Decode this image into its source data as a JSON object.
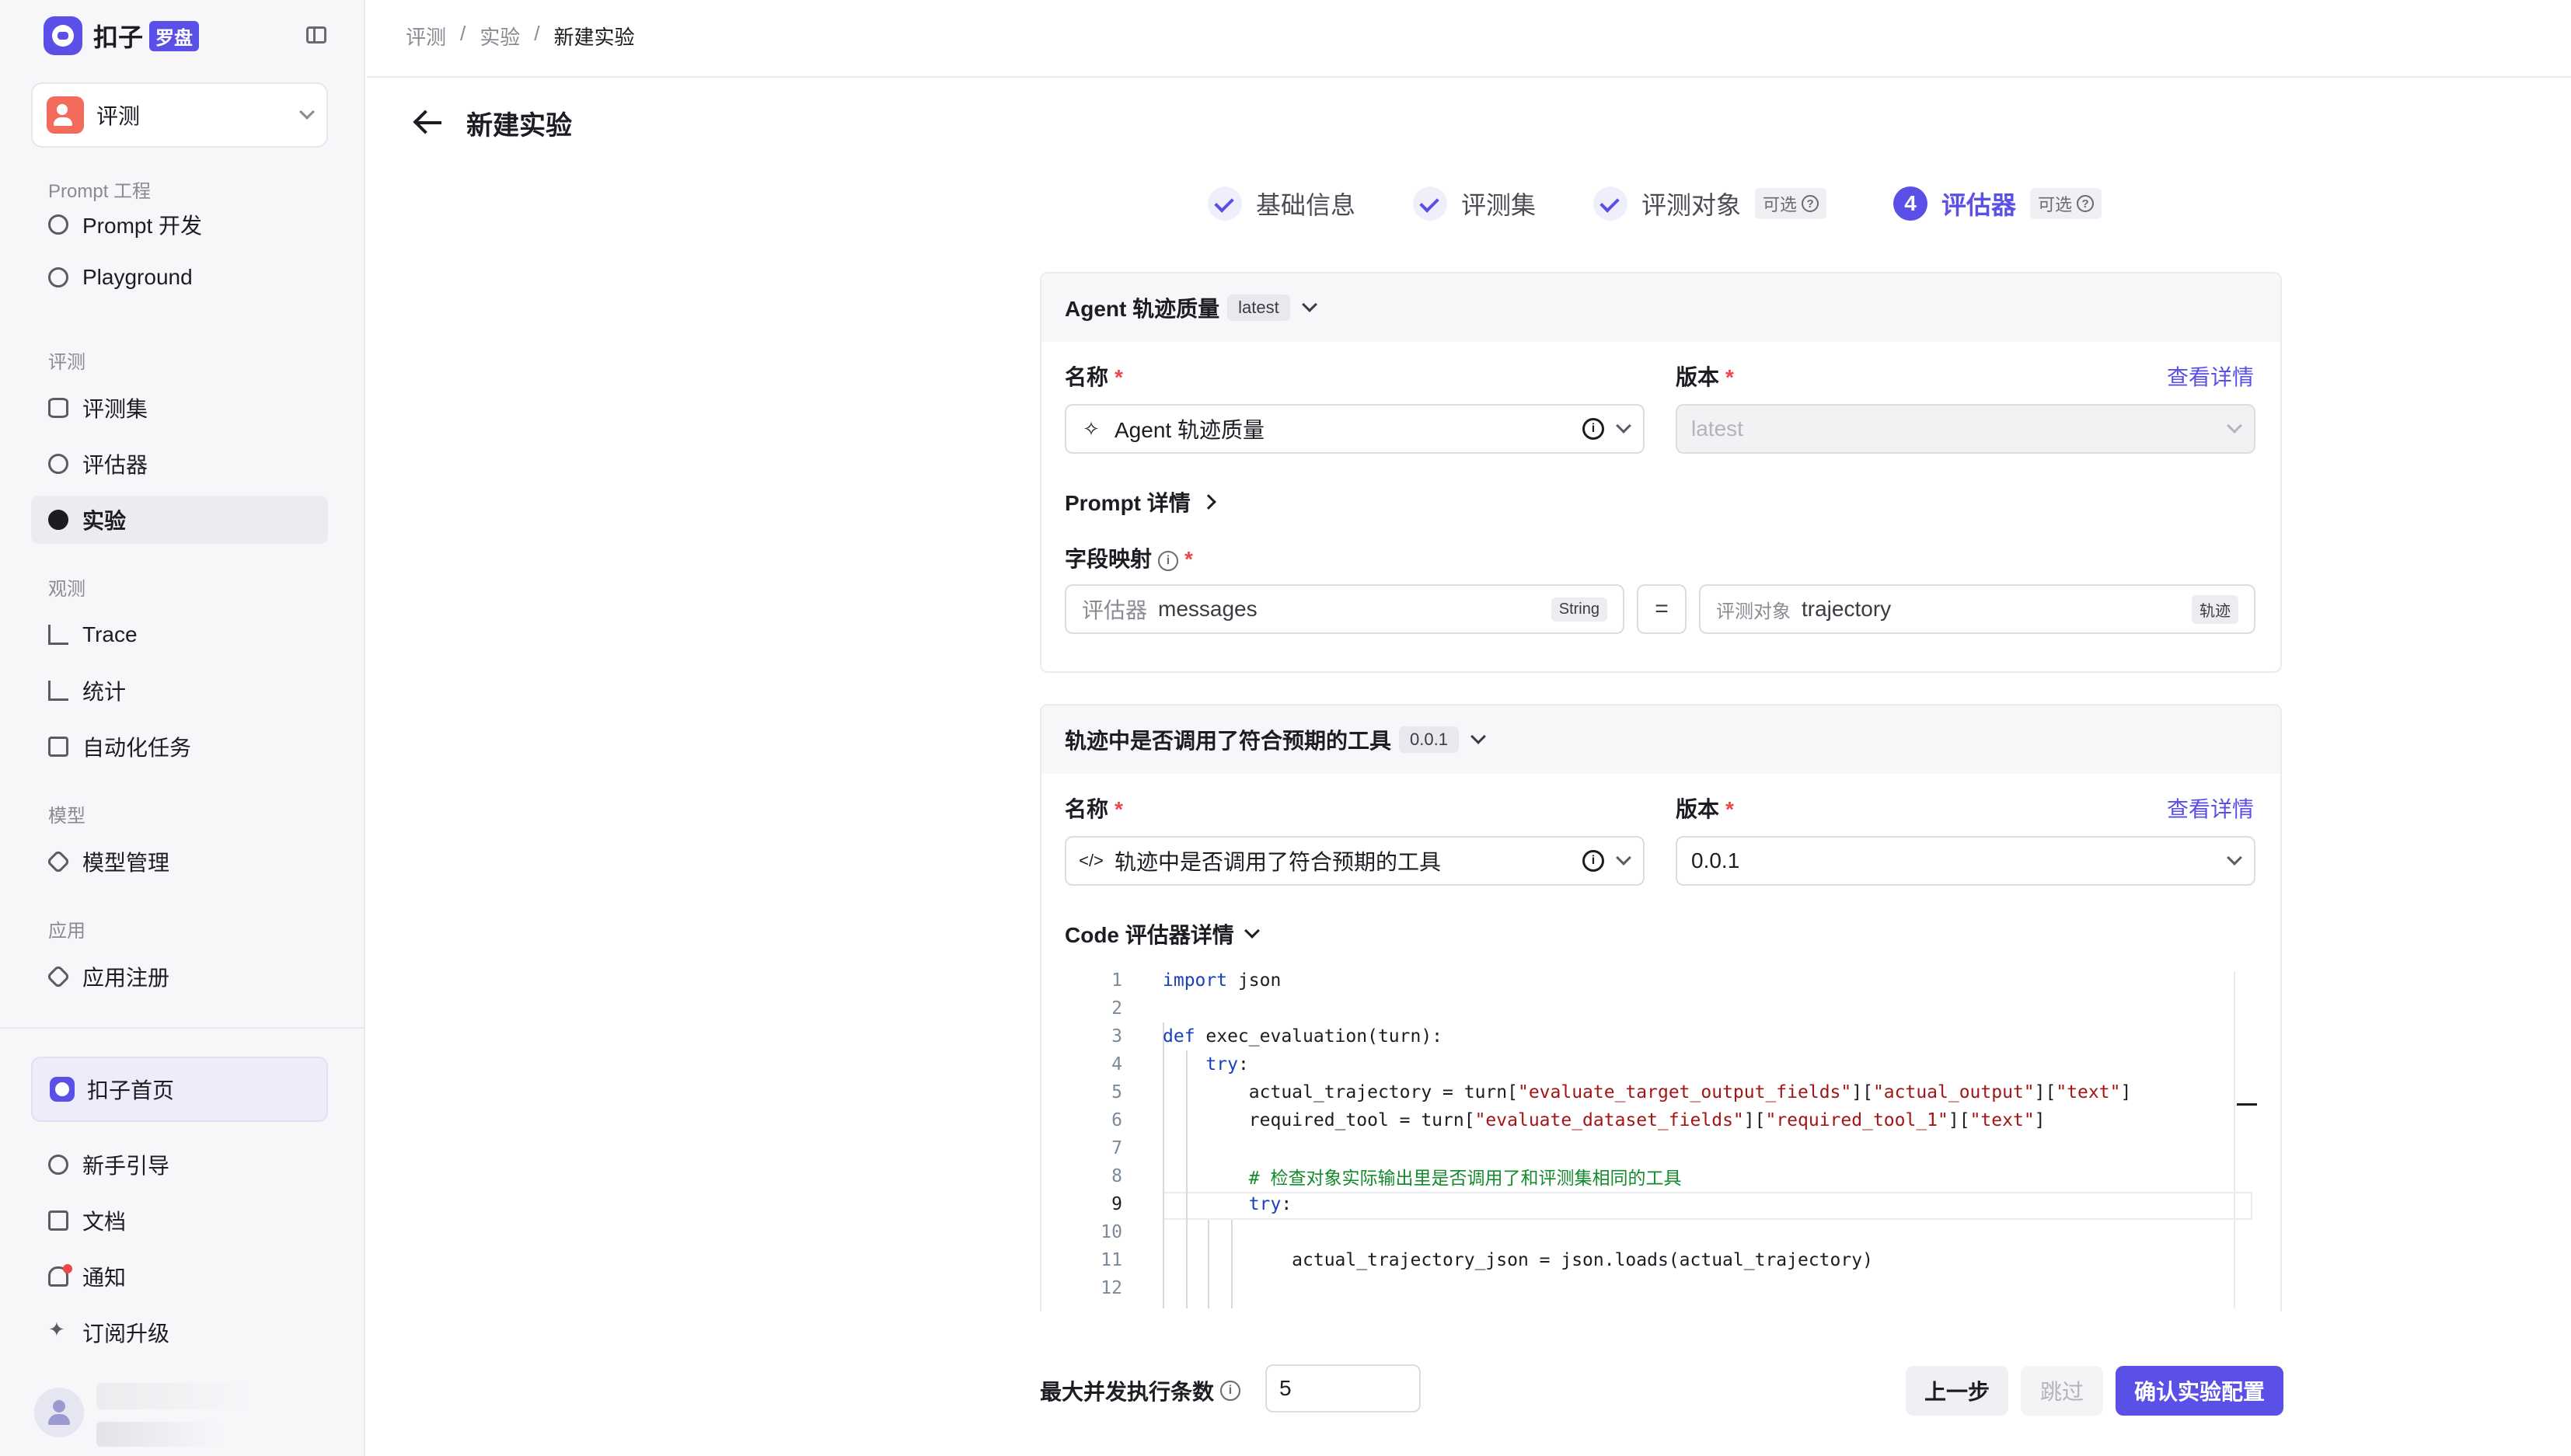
{
  "app": {
    "name": "扣子",
    "badge": "罗盘"
  },
  "space": {
    "label": "评测"
  },
  "sidebar": {
    "groups": [
      {
        "title": "Prompt 工程",
        "items": [
          {
            "label": "Prompt 开发",
            "icon": "chat-icon"
          },
          {
            "label": "Playground",
            "icon": "play-icon"
          }
        ]
      },
      {
        "title": "评测",
        "items": [
          {
            "label": "评测集",
            "icon": "database-icon"
          },
          {
            "label": "评估器",
            "icon": "bulb-icon"
          },
          {
            "label": "实验",
            "icon": "experiment-icon",
            "active": true
          }
        ]
      },
      {
        "title": "观测",
        "items": [
          {
            "label": "Trace",
            "icon": "trace-icon"
          },
          {
            "label": "统计",
            "icon": "chart-icon"
          },
          {
            "label": "自动化任务",
            "icon": "task-icon"
          }
        ]
      },
      {
        "title": "模型",
        "items": [
          {
            "label": "模型管理",
            "icon": "model-icon"
          }
        ]
      },
      {
        "title": "应用",
        "items": [
          {
            "label": "应用注册",
            "icon": "box-icon"
          }
        ]
      }
    ],
    "home": "扣子首页",
    "bottom": [
      {
        "label": "新手引导",
        "icon": "help-icon"
      },
      {
        "label": "文档",
        "icon": "doc-icon"
      },
      {
        "label": "通知",
        "icon": "bell-icon"
      },
      {
        "label": "订阅升级",
        "icon": "sparkle-icon"
      }
    ]
  },
  "breadcrumb": [
    "评测",
    "实验",
    "新建实验"
  ],
  "page_title": "新建实验",
  "steps": [
    {
      "label": "基础信息",
      "state": "done"
    },
    {
      "label": "评测集",
      "state": "done"
    },
    {
      "label": "评测对象",
      "state": "done",
      "tag": "可选"
    },
    {
      "label": "评估器",
      "state": "active",
      "num": "4",
      "tag": "可选"
    }
  ],
  "evaluator1": {
    "header": "Agent 轨迹质量",
    "header_version": "latest",
    "name_label": "名称",
    "version_label": "版本",
    "detail_link": "查看详情",
    "name_value": "Agent 轨迹质量",
    "version_value": "latest",
    "prompt_detail": "Prompt 详情",
    "mapping_label": "字段映射",
    "mapping": {
      "left_prefix": "评估器",
      "left_value": "messages",
      "left_type": "String",
      "eq": "=",
      "right_prefix": "评测对象",
      "right_value": "trajectory",
      "right_type": "轨迹"
    }
  },
  "evaluator2": {
    "header": "轨迹中是否调用了符合预期的工具",
    "header_version": "0.0.1",
    "name_label": "名称",
    "version_label": "版本",
    "detail_link": "查看详情",
    "name_value": "轨迹中是否调用了符合预期的工具",
    "version_value": "0.0.1",
    "code_detail": "Code 评估器详情",
    "code_lines": [
      "import json",
      "",
      "def exec_evaluation(turn):",
      "    try:",
      "        actual_trajectory = turn[\"evaluate_target_output_fields\"][\"actual_output\"][\"text\"]",
      "        required_tool = turn[\"evaluate_dataset_fields\"][\"required_tool_1\"][\"text\"]",
      "",
      "        # 检查对象实际输出里是否调用了和评测集相同的工具",
      "        try:",
      "",
      "            actual_trajectory_json = json.loads(actual_trajectory)",
      ""
    ],
    "line_numbers": [
      "1",
      "2",
      "3",
      "4",
      "5",
      "6",
      "7",
      "8",
      "9",
      "10",
      "11",
      "12"
    ]
  },
  "footer": {
    "concurrency_label": "最大并发执行条数",
    "concurrency_value": "5",
    "prev": "上一步",
    "skip": "跳过",
    "confirm": "确认实验配置"
  },
  "colors": {
    "accent": "#5a4fe6",
    "required": "#f0454a"
  }
}
